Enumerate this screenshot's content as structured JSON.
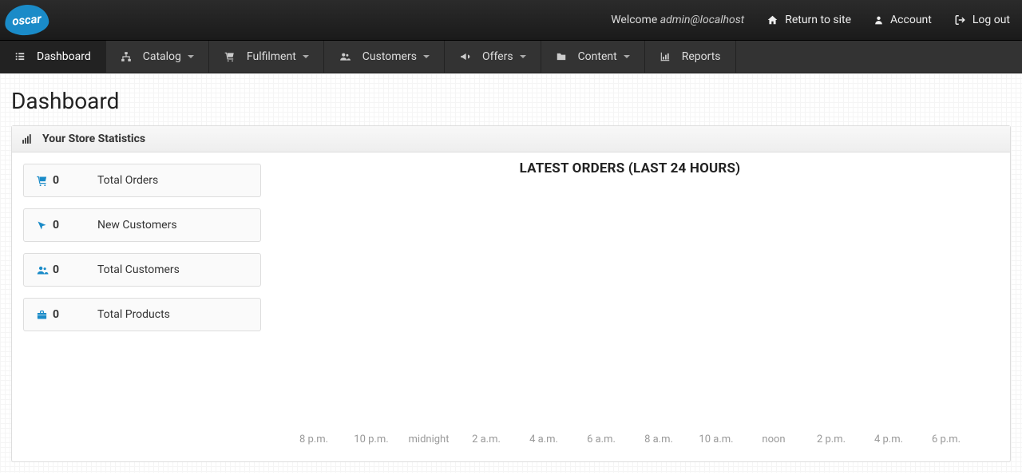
{
  "header": {
    "logo_text": "oscar",
    "welcome_prefix": "Welcome ",
    "welcome_user": "admin@localhost",
    "return_to_site": "Return to site",
    "account": "Account",
    "logout": "Log out"
  },
  "nav": {
    "dashboard": "Dashboard",
    "catalog": "Catalog",
    "fulfilment": "Fulfilment",
    "customers": "Customers",
    "offers": "Offers",
    "content": "Content",
    "reports": "Reports"
  },
  "page": {
    "title": "Dashboard"
  },
  "stats_panel": {
    "header": "Your Store Statistics",
    "items": [
      {
        "value": "0",
        "label": "Total Orders"
      },
      {
        "value": "0",
        "label": "New Customers"
      },
      {
        "value": "0",
        "label": "Total Customers"
      },
      {
        "value": "0",
        "label": "Total Products"
      }
    ]
  },
  "chart_data": {
    "type": "bar",
    "title": "LATEST ORDERS (LAST 24 HOURS)",
    "categories": [
      "8 p.m.",
      "10 p.m.",
      "midnight",
      "2 a.m.",
      "4 a.m.",
      "6 a.m.",
      "8 a.m.",
      "10 a.m.",
      "noon",
      "2 p.m.",
      "4 p.m.",
      "6 p.m."
    ],
    "values": [
      0,
      0,
      0,
      0,
      0,
      0,
      0,
      0,
      0,
      0,
      0,
      0
    ],
    "xlabel": "",
    "ylabel": "",
    "ylim": [
      0,
      1
    ]
  }
}
